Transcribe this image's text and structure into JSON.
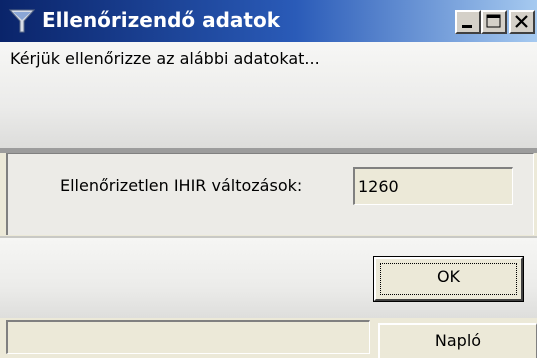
{
  "window": {
    "title": "Ellenőrizendő adatok",
    "icon": "funnel-icon",
    "accent": "#0a246a"
  },
  "message": {
    "text": "Kérjük ellenőrizze az alábbi adatokat..."
  },
  "field": {
    "label": "Ellenőrizetlen IHIR változások:",
    "value": "1260"
  },
  "buttons": {
    "ok": "OK",
    "log": "Napló"
  },
  "titlebar_buttons": [
    "minimize-icon",
    "maximize-icon",
    "close-icon"
  ]
}
